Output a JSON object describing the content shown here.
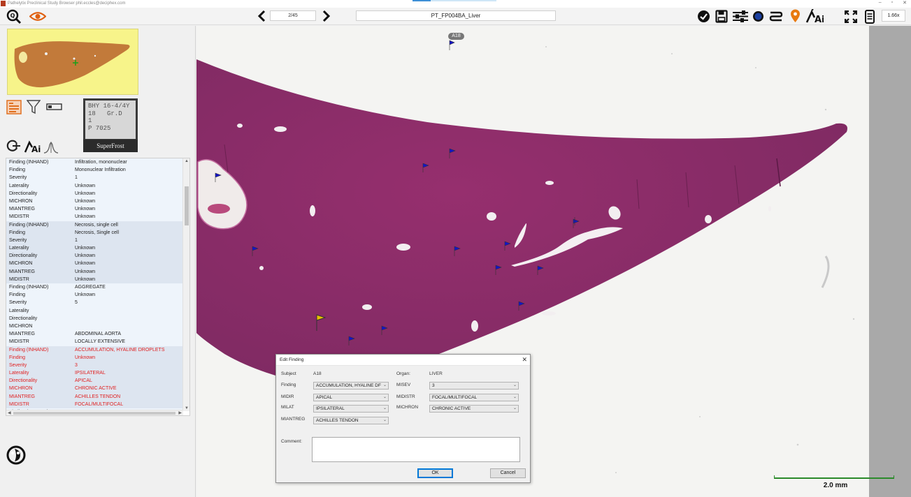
{
  "window": {
    "title": "Pathelytix Preclinical Study Browser phil.eccles@deciphex.com",
    "controls": [
      "–",
      "▫",
      "✕"
    ]
  },
  "toolbar": {
    "page": "2/45",
    "slide_name": "PT_FP004BA_Liver",
    "zoom": "1.66x",
    "icons": [
      "zoom-search-icon",
      "eye-icon",
      "prev-arrow-icon",
      "next-arrow-icon",
      "checkmark-icon",
      "save-icon",
      "sliders-icon",
      "dot-icon",
      "swap-icon",
      "location-pin-icon",
      "ai-icon",
      "fullscreen-icon",
      "device-icon"
    ]
  },
  "slide_label": {
    "text": "BHY 16-4/4Y\n18   Gr.D\n1\nP 7025",
    "brand": "SuperFrost"
  },
  "findings": [
    {
      "group": 0,
      "red": false,
      "rows": [
        [
          "Finding (INHAND)",
          "Infiltration, mononuclear"
        ],
        [
          "Finding",
          "Mononuclear Infiltration"
        ],
        [
          "Severity",
          "1"
        ],
        [
          "Laterality",
          "Unknown"
        ],
        [
          "Directionality",
          "Unknown"
        ],
        [
          "MICHRON",
          "Unknown"
        ],
        [
          "MIANTREG",
          "Unknown"
        ],
        [
          "MIDISTR",
          "Unknown"
        ]
      ]
    },
    {
      "group": 1,
      "red": false,
      "rows": [
        [
          "Finding (INHAND)",
          "Necrosis, single cell"
        ],
        [
          "Finding",
          "Necrosis, Single cell"
        ],
        [
          "Severity",
          "1"
        ],
        [
          "Laterality",
          "Unknown"
        ],
        [
          "Directionality",
          "Unknown"
        ],
        [
          "MICHRON",
          "Unknown"
        ],
        [
          "MIANTREG",
          "Unknown"
        ],
        [
          "MIDISTR",
          "Unknown"
        ]
      ]
    },
    {
      "group": 0,
      "red": false,
      "rows": [
        [
          "Finding (INHAND)",
          "AGGREGATE"
        ],
        [
          "Finding",
          "Unknown"
        ],
        [
          "Severity",
          "5"
        ],
        [
          "Laterality",
          ""
        ],
        [
          "Directionality",
          ""
        ],
        [
          "MICHRON",
          ""
        ],
        [
          "MIANTREG",
          "ABDOMINAL AORTA"
        ],
        [
          "MIDISTR",
          "LOCALLY EXTENSIVE"
        ]
      ]
    },
    {
      "group": 1,
      "red": true,
      "rows": [
        [
          "Finding (INHAND)",
          "ACCUMULATION, HYALINE DROPLETS"
        ],
        [
          "Finding",
          "Unknown"
        ],
        [
          "Severity",
          "3"
        ],
        [
          "Laterality",
          "IPSILATERAL"
        ],
        [
          "Directionality",
          "APICAL"
        ],
        [
          "MICHRON",
          "CHRONIC ACTIVE"
        ],
        [
          "MIANTREG",
          "ACHILLES TENDON"
        ],
        [
          "MIDISTR",
          "FOCAL/MULTIFOCAL"
        ]
      ]
    },
    {
      "group": 0,
      "red": false,
      "rows": [
        [
          "Finding (INHAND)",
          "ACCESSORY TISSUE"
        ]
      ]
    }
  ],
  "viewer": {
    "annotation_label": "A18",
    "scale_label": "2.0 mm"
  },
  "dialog": {
    "title": "Edit Finding",
    "subject_label": "Subject",
    "subject_value": "A18",
    "organ_label": "Organ:",
    "organ_value": "LIVER",
    "finding_label": "Finding",
    "finding_value": "ACCUMULATION, HYALINE DF",
    "midir_label": "MIDIR",
    "midir_value": "APICAL",
    "milat_label": "MILAT",
    "milat_value": "IPSILATERAL",
    "miantreg_label": "MIANTREG",
    "miantreg_value": "ACHILLES TENDON",
    "misev_label": "MISEV",
    "misev_value": "3",
    "midistr_label": "MIDISTR",
    "midistr_value": "FOCAL/MULTIFOCAL",
    "michron_label": "MICHRON",
    "michron_value": "CHRONIC ACTIVE",
    "comment_label": "Comment:",
    "ok_label": "OK",
    "cancel_label": "Cancel"
  },
  "colors": {
    "tissue": "#8e2f6a",
    "flag_blue": "#1414c8",
    "flag_yellow": "#e8c000",
    "finding_red": "#e02020",
    "scalebar": "#2a8a2a"
  }
}
